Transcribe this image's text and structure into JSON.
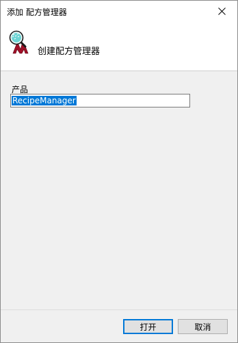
{
  "window": {
    "title": "添加 配方管理器"
  },
  "header": {
    "subtitle": "创建配方管理器"
  },
  "form": {
    "product_label": "产品",
    "product_value": "RecipeManager"
  },
  "buttons": {
    "open": "打开",
    "cancel": "取消"
  },
  "icons": {
    "close": "close-icon",
    "app": "recipe-manager-magnifier-icon"
  },
  "colors": {
    "accent": "#0078d7",
    "icon_m": "#a01028",
    "icon_lens": "#00b4b4"
  }
}
